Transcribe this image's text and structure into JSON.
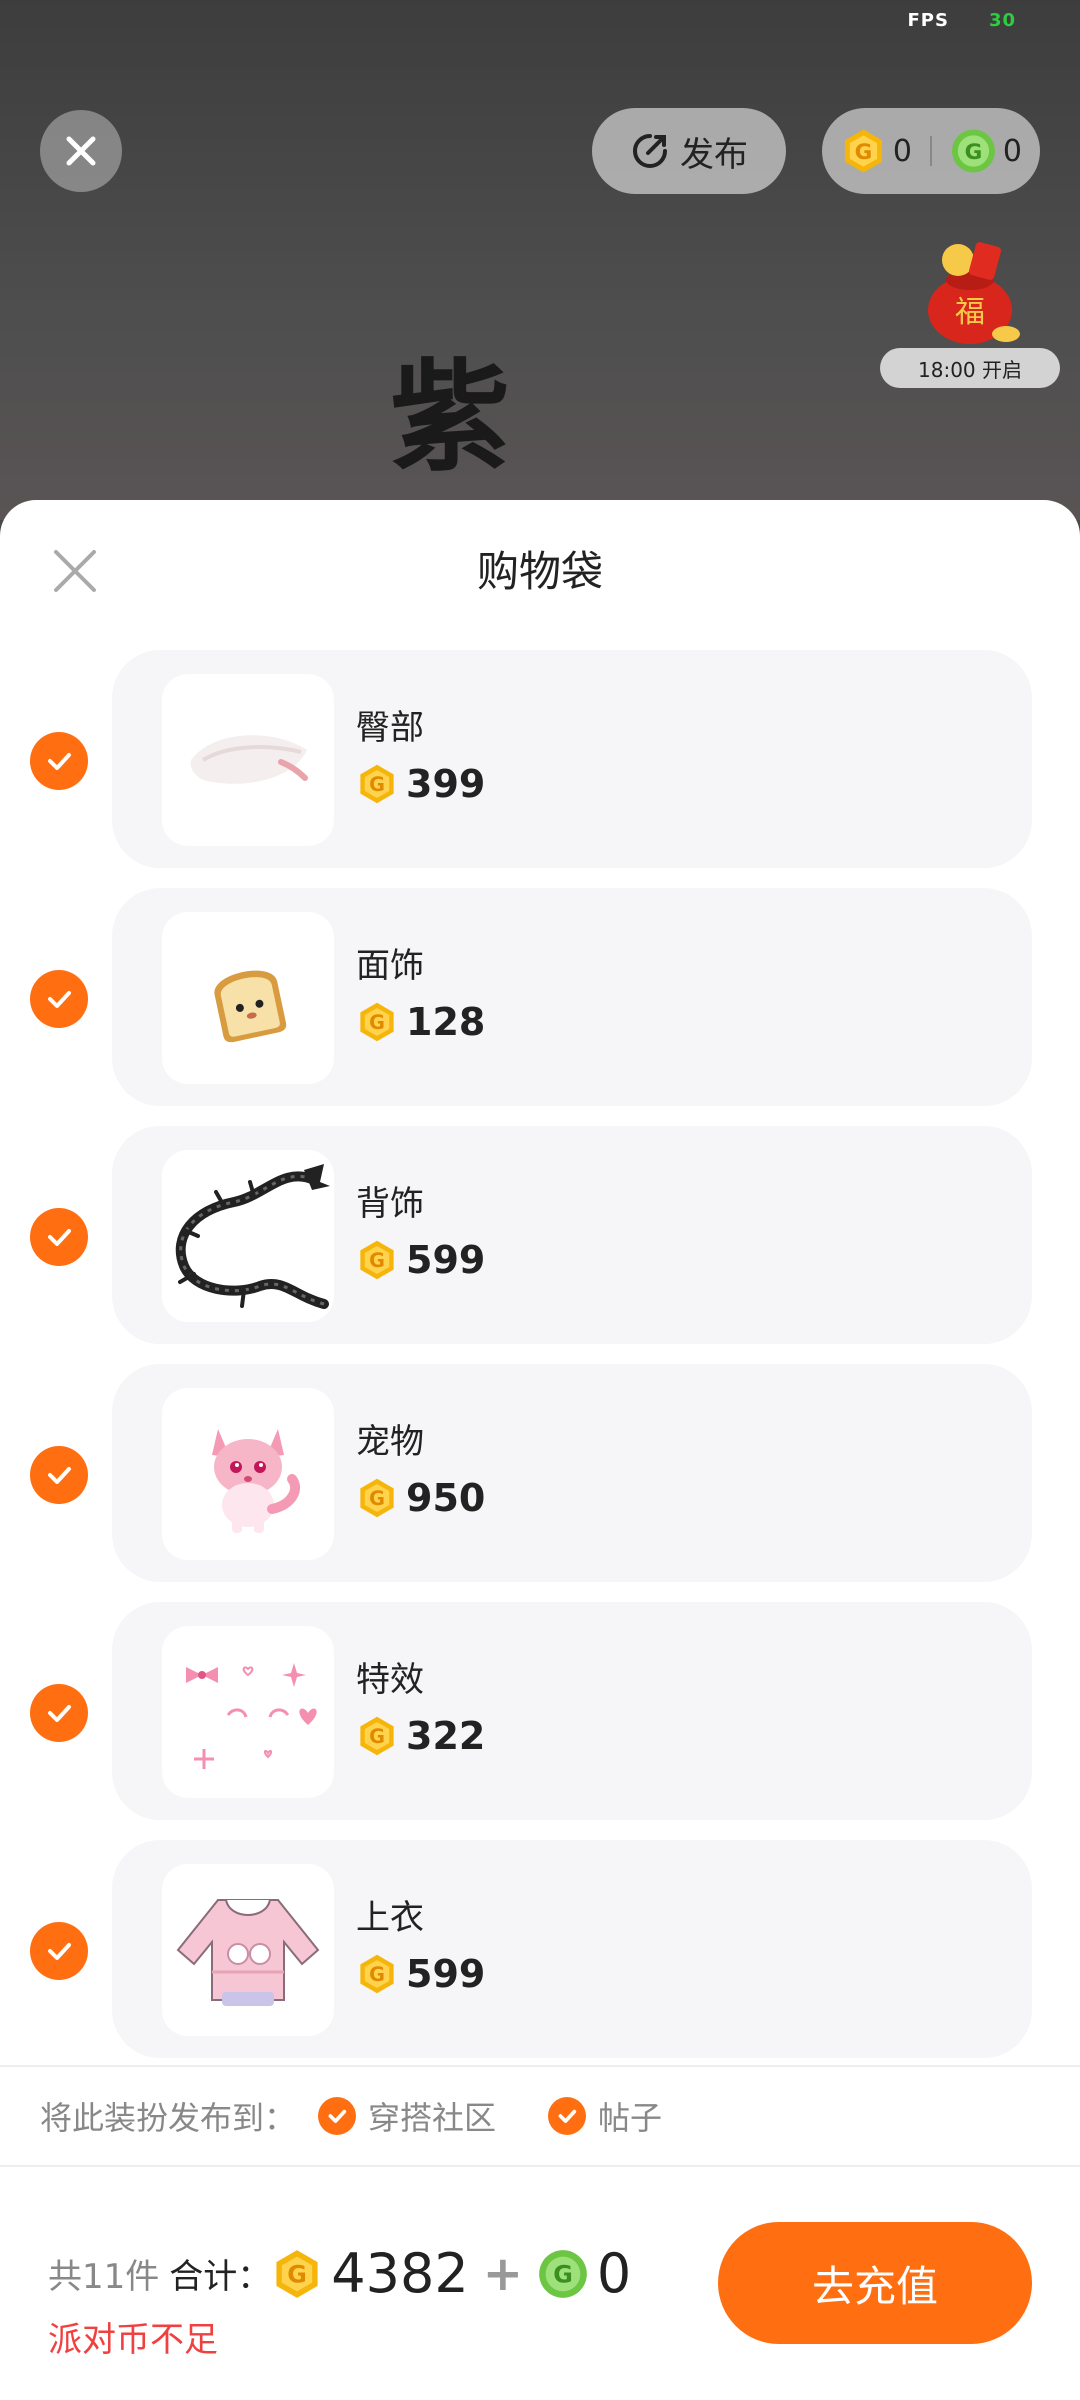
{
  "status": {
    "fps_label": "FPS",
    "fps_value": "30"
  },
  "top_bar": {
    "publish_label": "发布",
    "gold_balance": "0",
    "green_balance": "0"
  },
  "event": {
    "time_label": "18:00 开启"
  },
  "background_text": "紫",
  "sheet": {
    "title": "购物袋",
    "items": [
      {
        "name": "臀部",
        "price": "399",
        "icon": "fluffy-tail-item"
      },
      {
        "name": "面饰",
        "price": "128",
        "icon": "toast-face-item"
      },
      {
        "name": "背饰",
        "price": "599",
        "icon": "black-dragon-item"
      },
      {
        "name": "宠物",
        "price": "950",
        "icon": "pink-fox-pet"
      },
      {
        "name": "特效",
        "price": "322",
        "icon": "pink-sparkle-effect"
      },
      {
        "name": "上衣",
        "price": "599",
        "icon": "pink-hoodie-item"
      }
    ],
    "publish_to": {
      "label": "将此装扮发布到：",
      "options": [
        "穿搭社区",
        "帖子"
      ]
    },
    "footer": {
      "count_label": "共11件",
      "total_label": "合计：",
      "gold_total": "4382",
      "plus": "+",
      "green_total": "0",
      "warning": "派对币不足",
      "recharge_label": "去充值"
    }
  },
  "colors": {
    "accent": "#ff6f12",
    "warning": "#f04141",
    "gold_coin": "#f5b50a",
    "green_coin": "#6cc644"
  }
}
